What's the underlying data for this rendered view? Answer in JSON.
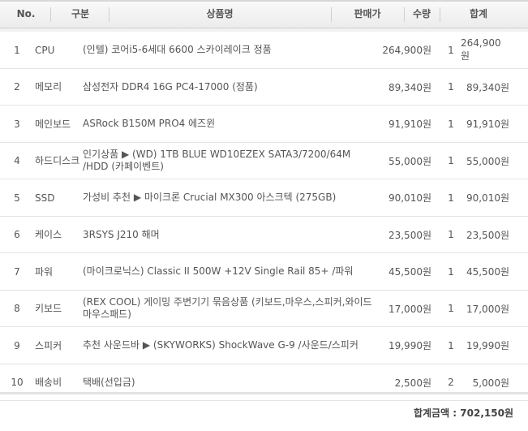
{
  "header": {
    "no": "No.",
    "category": "구분",
    "product": "상품명",
    "price": "판매가",
    "qty": "수량",
    "total": "합계"
  },
  "rows": [
    {
      "no": "1",
      "category": "CPU",
      "product": "(인텔) 코어i5-6세대 6600 스카이레이크 정품",
      "price": "264,900원",
      "qty": "1",
      "total": "264,900원"
    },
    {
      "no": "2",
      "category": "메모리",
      "product": "삼성전자 DDR4 16G PC4-17000 (정품)",
      "price": "89,340원",
      "qty": "1",
      "total": "89,340원"
    },
    {
      "no": "3",
      "category": "메인보드",
      "product": "ASRock B150M PRO4 에즈윈",
      "price": "91,910원",
      "qty": "1",
      "total": "91,910원"
    },
    {
      "no": "4",
      "category": "하드디스크",
      "product": "인기상품 ▶ (WD) 1TB BLUE WD10EZEX SATA3/7200/64M /HDD (카페이벤트)",
      "price": "55,000원",
      "qty": "1",
      "total": "55,000원"
    },
    {
      "no": "5",
      "category": "SSD",
      "product": "가성비 추천 ▶ 마이크론 Crucial MX300 아스크텍 (275GB)",
      "price": "90,010원",
      "qty": "1",
      "total": "90,010원"
    },
    {
      "no": "6",
      "category": "케이스",
      "product": "3RSYS J210 해머",
      "price": "23,500원",
      "qty": "1",
      "total": "23,500원"
    },
    {
      "no": "7",
      "category": "파워",
      "product": "(마이크로닉스) Classic II 500W +12V Single Rail 85+ /파워",
      "price": "45,500원",
      "qty": "1",
      "total": "45,500원"
    },
    {
      "no": "8",
      "category": "키보드",
      "product": "(REX COOL) 게이밍 주변기기 묶음상품 (키보드,마우스,스피커,와이드 마우스패드)",
      "price": "17,000원",
      "qty": "1",
      "total": "17,000원"
    },
    {
      "no": "9",
      "category": "스피커",
      "product": "추천 사운드바 ▶ (SKYWORKS) ShockWave G-9 /사운드/스피커",
      "price": "19,990원",
      "qty": "1",
      "total": "19,990원"
    },
    {
      "no": "10",
      "category": "배송비",
      "product": "택배(선입금)",
      "price": "2,500원",
      "qty": "2",
      "total": "5,000원"
    }
  ],
  "footer": {
    "label": "합계금액 : ",
    "amount": "702,150원"
  }
}
